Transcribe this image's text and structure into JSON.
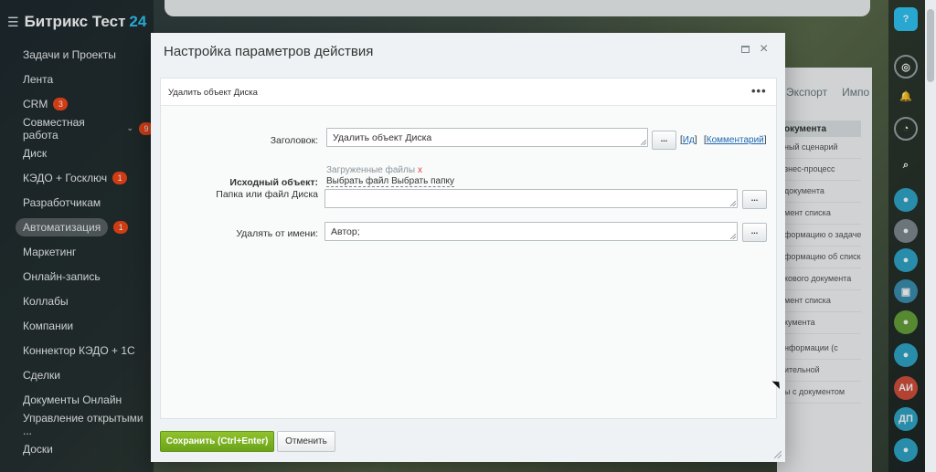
{
  "sidebar": {
    "brand": "Битрикс Тест",
    "brand_suffix": "24",
    "items": [
      {
        "label": "Задачи и Проекты",
        "badge": ""
      },
      {
        "label": "Лента",
        "badge": ""
      },
      {
        "label": "CRM",
        "badge": "3"
      },
      {
        "label": "Совместная работа",
        "badge": "9"
      },
      {
        "label": "Диск",
        "badge": ""
      },
      {
        "label": "КЭДО + Госключ",
        "badge": "1"
      },
      {
        "label": "Разработчикам",
        "badge": ""
      },
      {
        "label": "Автоматизация",
        "badge": "1"
      },
      {
        "label": "Маркетинг",
        "badge": ""
      },
      {
        "label": "Онлайн-запись",
        "badge": ""
      },
      {
        "label": "Коллабы",
        "badge": ""
      },
      {
        "label": "Компании",
        "badge": ""
      },
      {
        "label": "Коннектор КЭДО + 1С",
        "badge": ""
      },
      {
        "label": "Сделки",
        "badge": ""
      },
      {
        "label": "Документы Онлайн",
        "badge": ""
      },
      {
        "label": "Управление открытыми ...",
        "badge": ""
      },
      {
        "label": "Доски",
        "badge": ""
      }
    ]
  },
  "background": {
    "tabs": [
      "Экспорт",
      "Импо"
    ],
    "list_header": "окумента",
    "list_items": [
      "ный сценарий",
      "знес-процесс",
      "документа",
      "мент списка",
      "формацию о задаче",
      "формацию об списка",
      "кового документа",
      "мент списка",
      "кумента"
    ],
    "list2_items": [
      "нформации (с",
      "ительной",
      "ы с документом"
    ]
  },
  "rail": {
    "help": "?",
    "avatar1": "АИ",
    "avatar2": "ДП"
  },
  "dialog": {
    "title": "Настройка параметров действия",
    "section_title": "Удалить объект Диска",
    "fields": {
      "title_label": "Заголовок:",
      "title_value": "Удалить объект Диска",
      "id_link": "Ид",
      "comment_link": "Комментарий",
      "source_label": "Исходный объект:",
      "uploaded_files": "Загруженные файлы",
      "remove_x": "x",
      "choose_file": "Выбрать файл",
      "choose_folder": "Выбрать папку",
      "folder_label": "Папка или файл Диска",
      "folder_value": "",
      "delete_as_label": "Удалять от имени:",
      "delete_as_value": "Автор;",
      "dots": "..."
    },
    "save_label": "Сохранить (Ctrl+Enter)",
    "cancel_label": "Отменить"
  },
  "colors": {
    "accent": "#2fc6f6",
    "save_green": "#7bb321",
    "badge_red": "#f54819",
    "link_blue": "#2067b0"
  }
}
